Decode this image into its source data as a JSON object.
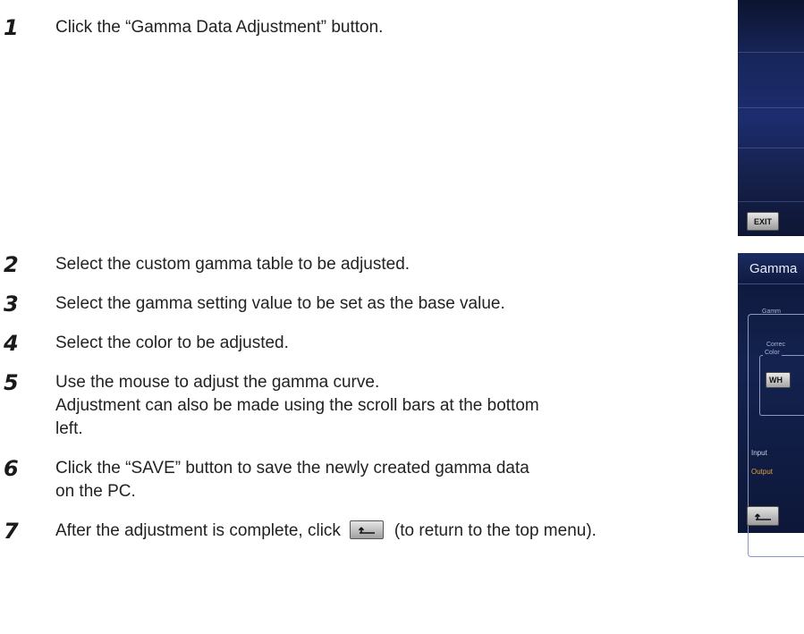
{
  "steps": [
    {
      "number": "1",
      "lines": [
        "Click the “Gamma Data Adjustment” button."
      ]
    },
    {
      "number": "2",
      "lines": [
        "Select the custom gamma table to be adjusted."
      ]
    },
    {
      "number": "3",
      "lines": [
        "Select the gamma setting value to be set as the base value."
      ]
    },
    {
      "number": "4",
      "lines": [
        "Select the color to be adjusted."
      ]
    },
    {
      "number": "5",
      "lines": [
        "Use the mouse to adjust the gamma curve.",
        "Adjustment can also be made using the scroll bars at the bottom",
        "left."
      ]
    },
    {
      "number": "6",
      "lines": [
        "Click the “SAVE” button to save the newly created gamma data",
        "on the PC."
      ]
    },
    {
      "number": "7",
      "before_icon": "After the adjustment is complete, click",
      "after_icon": "(to return to the top menu)."
    }
  ],
  "screenshot_top": {
    "exit_label": "EXIT",
    "background_color": "#1d2c6e"
  },
  "screenshot_bottom": {
    "title": "Gamma",
    "gamma_label": "Gamm",
    "correction_label": "Correc",
    "color_label": "Color",
    "color_button_label": "WH",
    "input_label": "Input",
    "output_label": "Output",
    "output_color": "#e0a23c"
  },
  "icons": {
    "return": "return-arrow-icon"
  }
}
